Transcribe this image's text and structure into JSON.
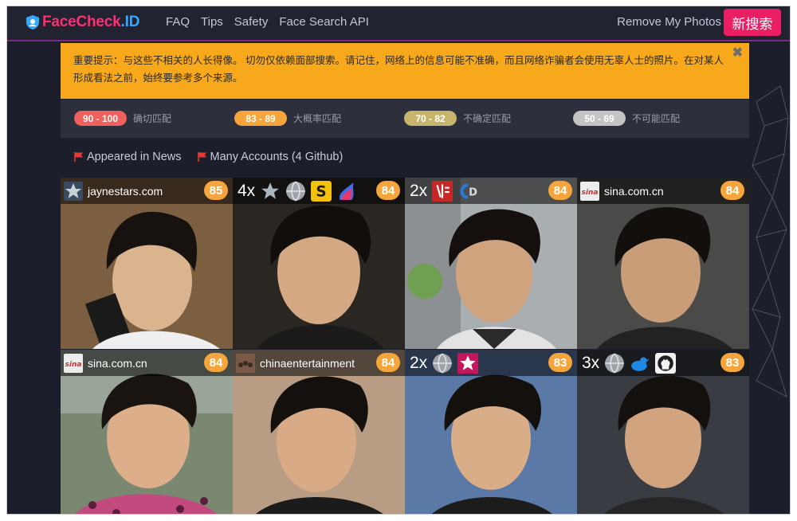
{
  "nav": {
    "logo_a": "FaceCheck",
    "logo_b": ".ID",
    "links": [
      "FAQ",
      "Tips",
      "Safety",
      "Face Search API"
    ],
    "remove": "Remove My Photos",
    "new_search": "新搜索"
  },
  "warning": {
    "text": "重要提示：与这些不相关的人长得像。 切勿仅依赖面部搜索。请记住，网络上的信息可能不准确，而且网络诈骗者会使用无辜人士的照片。在对某人形成看法之前，始终要参考多个来源。",
    "close": "✖"
  },
  "legend": [
    {
      "range": "90 - 100",
      "label": "确切匹配",
      "color": "#f0605c"
    },
    {
      "range": "83 - 89",
      "label": "大概率匹配",
      "color": "#f6a53c"
    },
    {
      "range": "70 - 82",
      "label": "不确定匹配",
      "color": "#c7b56c"
    },
    {
      "range": "50 - 69",
      "label": "不可能匹配",
      "color": "#c4c4c4"
    }
  ],
  "filters": [
    "Appeared in News",
    "Many Accounts (4 Github)"
  ],
  "results": [
    {
      "domain": "jaynestars.com",
      "count": "",
      "score": "85",
      "icons": [
        "star-icon"
      ]
    },
    {
      "domain": "",
      "count": "4x",
      "score": "84",
      "icons": [
        "star-icon",
        "globe-icon",
        "s-icon",
        "flame-icon"
      ]
    },
    {
      "domain": "",
      "count": "2x",
      "score": "84",
      "icons": [
        "red-logo-icon",
        "cd-icon"
      ]
    },
    {
      "domain": "sina.com.cn",
      "count": "",
      "score": "84",
      "icons": [
        "sina-icon"
      ]
    },
    {
      "domain": "sina.com.cn",
      "count": "",
      "score": "84",
      "icons": [
        "sina-icon"
      ]
    },
    {
      "domain": "chinaentertainment",
      "count": "",
      "score": "84",
      "icons": [
        "crowd-icon"
      ]
    },
    {
      "domain": "",
      "count": "2x",
      "score": "83",
      "icons": [
        "globe-icon",
        "pink-star-icon"
      ]
    },
    {
      "domain": "",
      "count": "3x",
      "score": "83",
      "icons": [
        "globe-icon",
        "bird-icon",
        "github-icon"
      ]
    }
  ],
  "colors": {
    "accent": "#e91e63",
    "warning": "#f7a81b",
    "background": "#1d1e2b",
    "score": "#f6a53c"
  }
}
